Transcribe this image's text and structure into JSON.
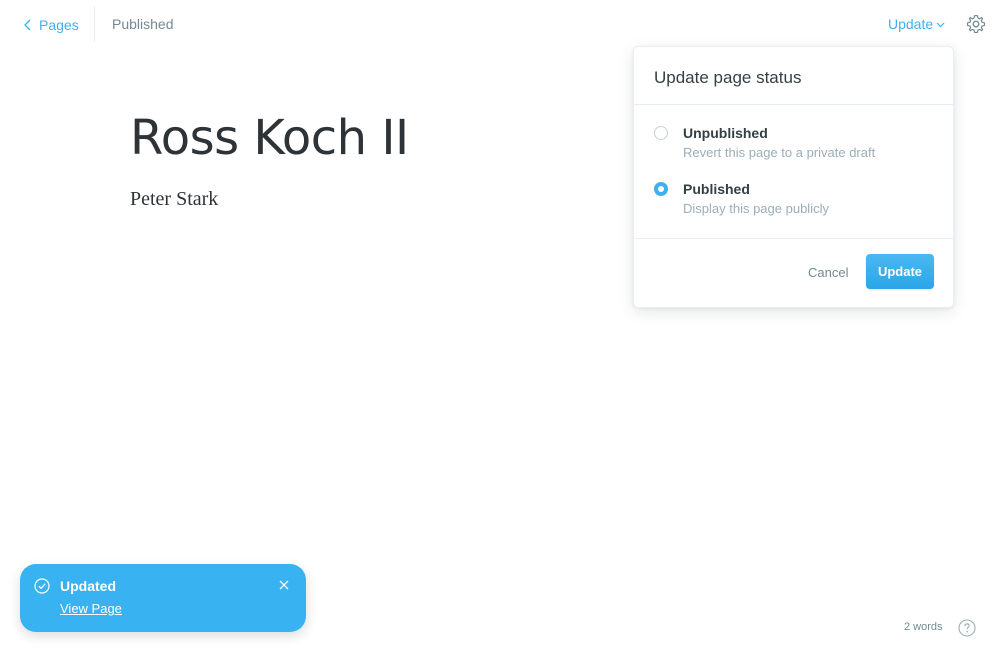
{
  "topbar": {
    "back_label": "Pages",
    "status": "Published",
    "update_label": "Update"
  },
  "editor": {
    "title": "Ross Koch II",
    "body": "Peter Stark"
  },
  "status_panel": {
    "heading": "Update page status",
    "options": [
      {
        "label": "Unpublished",
        "description": "Revert this page to a private draft",
        "selected": false
      },
      {
        "label": "Published",
        "description": "Display this page publicly",
        "selected": true
      }
    ],
    "cancel_label": "Cancel",
    "confirm_label": "Update"
  },
  "notification": {
    "title": "Updated",
    "link_label": "View Page"
  },
  "footer": {
    "word_count": "2 words"
  },
  "colors": {
    "accent": "#3eb0ef",
    "toast_background": "#38b2f1",
    "muted_text": "#738a94",
    "title_text": "#2e3338"
  },
  "icons": {
    "back": "chevron-left-icon",
    "dropdown": "chevron-down-icon",
    "settings": "gear-icon",
    "toast_status": "check-circle-icon",
    "toast_close": "close-icon",
    "help": "question-circle-icon"
  }
}
